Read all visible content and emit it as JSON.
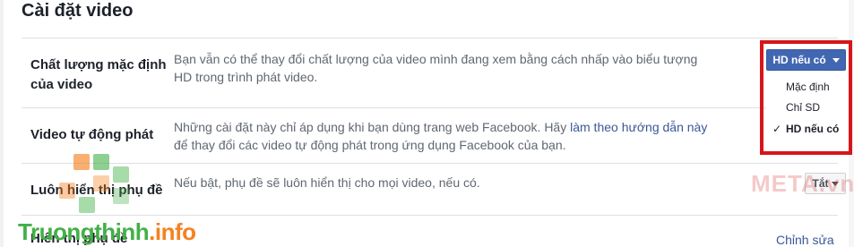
{
  "section": {
    "title": "Cài đặt video"
  },
  "rows": [
    {
      "label_line1": "Chất lượng mặc định",
      "label_line2": "của video",
      "desc_line1": "Bạn vẫn có thể thay đổi chất lượng của video mình đang xem bằng cách nhấp vào biểu tượng",
      "desc_line2": "HD trong trình phát video."
    },
    {
      "label": "Video tự động phát",
      "desc_line1_prefix": "Những cài đặt này chỉ áp dụng khi bạn dùng trang web Facebook. Hãy ",
      "desc_link": "làm theo hướng dẫn này",
      "desc_line2": "để thay đổi các video tự động phát trong ứng dụng Facebook của bạn."
    },
    {
      "label": "Luôn hiển thị phụ đề",
      "desc": "Nếu bật, phụ đề sẽ luôn hiển thị cho mọi video, nếu có.",
      "button_label": "Tắt"
    },
    {
      "label": "Hiển thị phụ đề",
      "edit_label": "Chỉnh sửa"
    }
  ],
  "quality_dropdown": {
    "button_label": "HD nếu có",
    "options": [
      "Mặc định",
      "Chỉ SD",
      "HD nếu có"
    ],
    "selected": "HD nếu có",
    "check_glyph": "✓"
  },
  "watermarks": {
    "meta": "META.vn",
    "site_part1": "Truongthinh",
    "site_part2": ".info"
  },
  "colors": {
    "accent_blue": "#4267b2",
    "link_blue": "#385898",
    "highlight_red": "#d7151a"
  }
}
